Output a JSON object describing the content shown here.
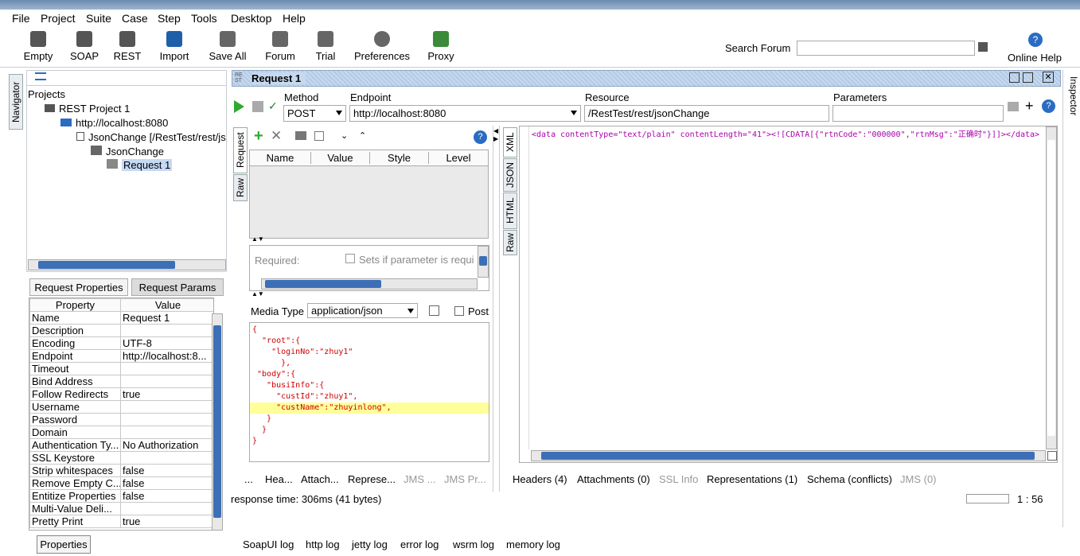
{
  "menu": {
    "items": [
      "File",
      "Project",
      "Suite",
      "Case",
      "Step",
      "Tools",
      "Desktop",
      "Help"
    ]
  },
  "toolbar": {
    "buttons": [
      "Empty",
      "SOAP",
      "REST",
      "Import",
      "Save All",
      "Forum",
      "Trial",
      "Preferences",
      "Proxy"
    ],
    "search_label": "Search Forum",
    "online_help": "Online Help"
  },
  "navigator": {
    "tab": "Navigator",
    "projects_label": "Projects",
    "tree": [
      "REST Project 1",
      "http://localhost:8080",
      "JsonChange [/RestTest/rest/js",
      "JsonChange",
      "Request 1"
    ]
  },
  "props": {
    "tab_request_props": "Request Properties",
    "tab_request_params": "Request Params",
    "col_property": "Property",
    "col_value": "Value",
    "rows": [
      [
        "Name",
        "Request 1"
      ],
      [
        "Description",
        ""
      ],
      [
        "Encoding",
        "UTF-8"
      ],
      [
        "Endpoint",
        "http://localhost:8..."
      ],
      [
        "Timeout",
        ""
      ],
      [
        "Bind Address",
        ""
      ],
      [
        "Follow Redirects",
        "true"
      ],
      [
        "Username",
        ""
      ],
      [
        "Password",
        ""
      ],
      [
        "Domain",
        ""
      ],
      [
        "Authentication Ty...",
        "No Authorization"
      ],
      [
        "SSL Keystore",
        ""
      ],
      [
        "Strip whitespaces",
        "false"
      ],
      [
        "Remove Empty C...",
        "false"
      ],
      [
        "Entitize Properties",
        "false"
      ],
      [
        "Multi-Value Deli...",
        ""
      ],
      [
        "Pretty Print",
        "true"
      ]
    ],
    "properties_button": "Properties"
  },
  "request": {
    "title": "Request 1",
    "method_label": "Method",
    "method": "POST",
    "endpoint_label": "Endpoint",
    "endpoint": "http://localhost:8080",
    "resource_label": "Resource",
    "resource": "/RestTest/rest/jsonChange",
    "parameters_label": "Parameters",
    "side_tabs": [
      "Request",
      "Raw"
    ],
    "param_cols": [
      "Name",
      "Value",
      "Style",
      "Level"
    ],
    "required_label": "Required:",
    "sets_param": "Sets if parameter is requi",
    "media_type_label": "Media Type",
    "media_type": "application/json",
    "post_label": "Post",
    "body_lines": [
      "{",
      "  \"root\":{",
      "    \"loginNo\":\"zhuy1\"",
      "      },",
      " \"body\":{",
      "   \"busiInfo\":{",
      "     \"custId\":\"zhuy1\",",
      "     \"custName\":\"zhuyinlong\",",
      "   }",
      "  }",
      "}"
    ],
    "bottom_tabs": [
      "...",
      "Hea...",
      "Attach...",
      "Represe...",
      "JMS ...",
      "JMS Pr..."
    ],
    "response_time": "response time: 306ms (41 bytes)"
  },
  "response": {
    "side_tabs": [
      "XML",
      "JSON",
      "HTML",
      "Raw"
    ],
    "content": "<data contentType=\"text/plain\" contentLength=\"41\"><![CDATA[{\"rtnCode\":\"000000\",\"rtnMsg\":\"正确时\"}]]></data>",
    "bottom_tabs": [
      "Headers (4)",
      "Attachments (0)",
      "SSL Info",
      "Representations (1)",
      "Schema (conflicts)",
      "JMS (0)"
    ],
    "position": "1 : 56"
  },
  "logs": [
    "SoapUI log",
    "http log",
    "jetty log",
    "error log",
    "wsrm log",
    "memory log"
  ],
  "inspector": "Inspector",
  "colors": {
    "accent": "#3c6fb6",
    "panel_header": "#c7d9ee",
    "highlight": "#ffff99",
    "selected": "#c6d9f3"
  }
}
